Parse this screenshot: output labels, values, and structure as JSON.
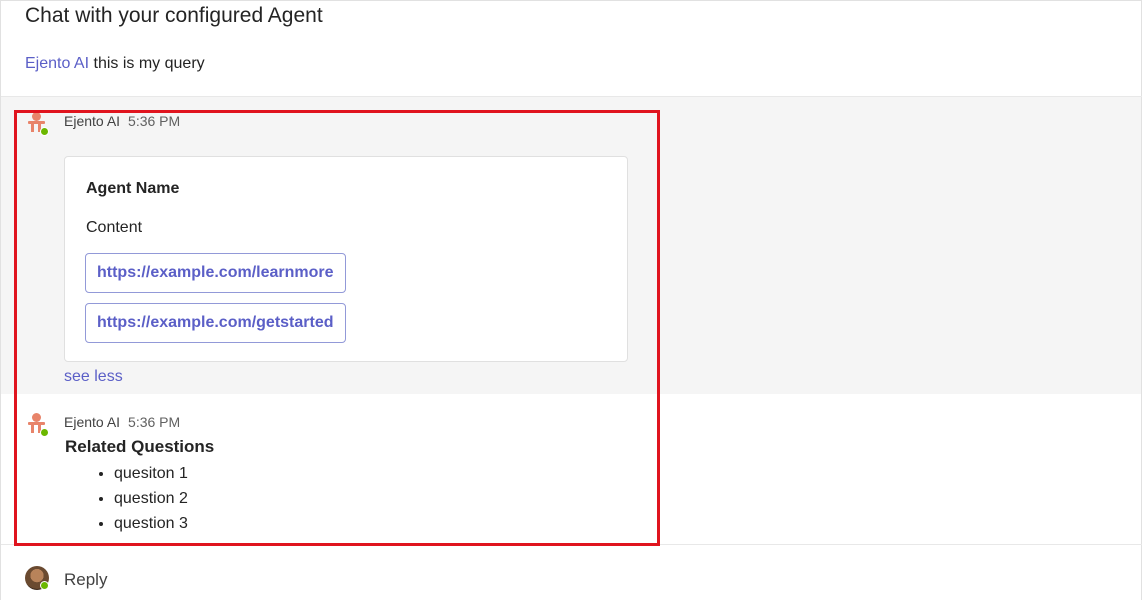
{
  "header": {
    "title": "Chat with your configured Agent"
  },
  "query": {
    "mention": "Ejento AI",
    "text": "this is my query"
  },
  "messages": [
    {
      "sender": "Ejento AI",
      "time": "5:36 PM",
      "card": {
        "title": "Agent Name",
        "content": "Content",
        "links": [
          "https://example.com/learnmore",
          "https://example.com/getstarted"
        ]
      },
      "toggle_label": "see less"
    },
    {
      "sender": "Ejento AI",
      "time": "5:36 PM",
      "related_title": "Related Questions",
      "related_items": [
        "quesiton 1",
        "question 2",
        "question 3"
      ]
    }
  ],
  "reply": {
    "label": "Reply"
  },
  "colors": {
    "accent": "#5b5fc7",
    "highlight": "#e0141e",
    "presence": "#6bb700",
    "bot_icon": "#e8846a"
  }
}
